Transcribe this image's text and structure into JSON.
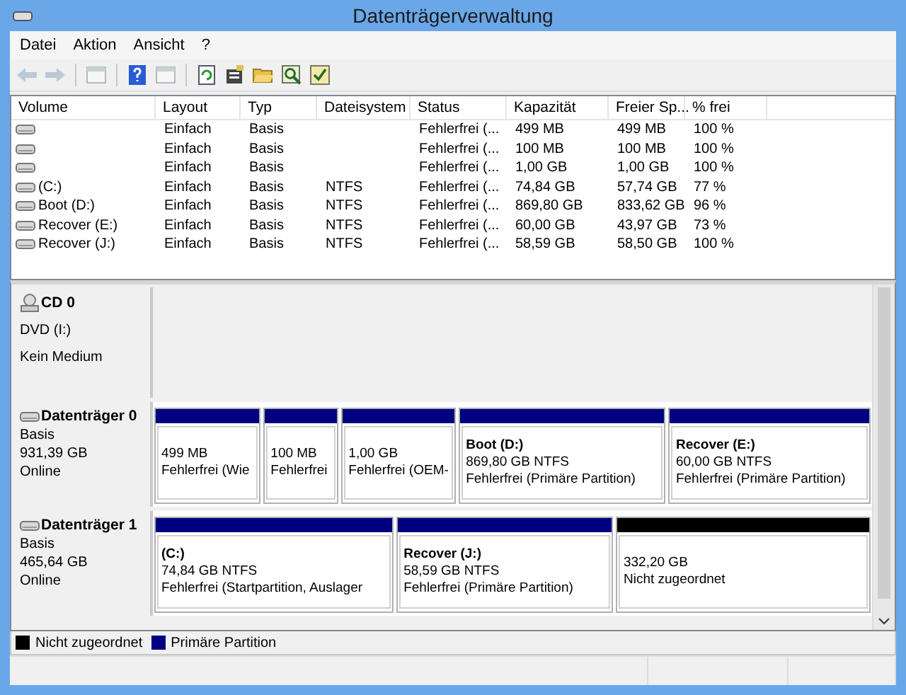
{
  "window": {
    "title": "Datenträgerverwaltung"
  },
  "menu": [
    "Datei",
    "Aktion",
    "Ansicht",
    "?"
  ],
  "toolbar": [
    {
      "kind": "back",
      "disabled": true
    },
    {
      "kind": "forward",
      "disabled": true
    },
    {
      "kind": "sep"
    },
    {
      "kind": "panel",
      "disabled": true
    },
    {
      "kind": "sep"
    },
    {
      "kind": "help",
      "disabled": false
    },
    {
      "kind": "panel",
      "disabled": true
    },
    {
      "kind": "sep"
    },
    {
      "kind": "refresh",
      "disabled": false
    },
    {
      "kind": "properties",
      "disabled": false
    },
    {
      "kind": "folder",
      "disabled": false
    },
    {
      "kind": "search",
      "disabled": false
    },
    {
      "kind": "check",
      "disabled": false
    }
  ],
  "table": {
    "columns": [
      "Volume",
      "Layout",
      "Typ",
      "Dateisystem",
      "Status",
      "Kapazität",
      "Freier Sp...",
      "% frei"
    ],
    "rows": [
      [
        null,
        "Einfach",
        "Basis",
        null,
        "Fehlerfrei (...",
        "499 MB",
        "499 MB",
        "100 %"
      ],
      [
        null,
        "Einfach",
        "Basis",
        null,
        "Fehlerfrei (...",
        "100 MB",
        "100 MB",
        "100 %"
      ],
      [
        null,
        "Einfach",
        "Basis",
        null,
        "Fehlerfrei (...",
        "1,00 GB",
        "1,00 GB",
        "100 %"
      ],
      [
        " (C:)",
        "Einfach",
        "Basis",
        "NTFS",
        "Fehlerfrei (...",
        "74,84 GB",
        "57,74 GB",
        "77 %"
      ],
      [
        "Boot (D:)",
        "Einfach",
        "Basis",
        "NTFS",
        "Fehlerfrei (...",
        "869,80 GB",
        "833,62 GB",
        "96 %"
      ],
      [
        "Recover (E:)",
        "Einfach",
        "Basis",
        "NTFS",
        "Fehlerfrei (...",
        "60,00 GB",
        "43,97 GB",
        "73 %"
      ],
      [
        "Recover (J:)",
        "Einfach",
        "Basis",
        "NTFS",
        "Fehlerfrei (...",
        "58,59 GB",
        "58,50 GB",
        "100 %"
      ]
    ]
  },
  "disks": [
    {
      "kind": "cd",
      "name": "CD 0",
      "lines": [
        "DVD (I:)",
        "Kein Medium"
      ]
    },
    {
      "kind": "disk",
      "name": "Datenträger 0",
      "lines": [
        "Basis",
        "931,39 GB",
        "Online"
      ],
      "partitions": [
        {
          "kind": "primary",
          "size": "499 MB",
          "status": "Fehlerfrei (Wie"
        },
        {
          "kind": "primary",
          "size": "100 MB",
          "status": "Fehlerfrei"
        },
        {
          "kind": "primary",
          "size": "1,00 GB",
          "status": "Fehlerfrei (OEM-"
        },
        {
          "kind": "primary",
          "title": "Boot  (D:)",
          "size": "869,80 GB NTFS",
          "status": "Fehlerfrei (Primäre Partition)"
        },
        {
          "kind": "primary",
          "title": "Recover  (E:)",
          "size": "60,00 GB NTFS",
          "status": "Fehlerfrei (Primäre Partition)"
        }
      ]
    },
    {
      "kind": "disk",
      "name": "Datenträger 1",
      "lines": [
        "Basis",
        "465,64 GB",
        "Online"
      ],
      "partitions": [
        {
          "kind": "primary",
          "title": " (C:)",
          "size": "74,84 GB NTFS",
          "status": "Fehlerfrei (Startpartition, Auslager"
        },
        {
          "kind": "primary",
          "title": "Recover  (J:)",
          "size": "58,59 GB NTFS",
          "status": "Fehlerfrei (Primäre Partition)"
        },
        {
          "kind": "unallocated",
          "size": "332,20 GB",
          "status": "Nicht zugeordnet"
        }
      ]
    }
  ],
  "legend": [
    {
      "label": "Nicht zugeordnet",
      "color": "#000000"
    },
    {
      "label": "Primäre Partition",
      "color": "#000080"
    }
  ]
}
